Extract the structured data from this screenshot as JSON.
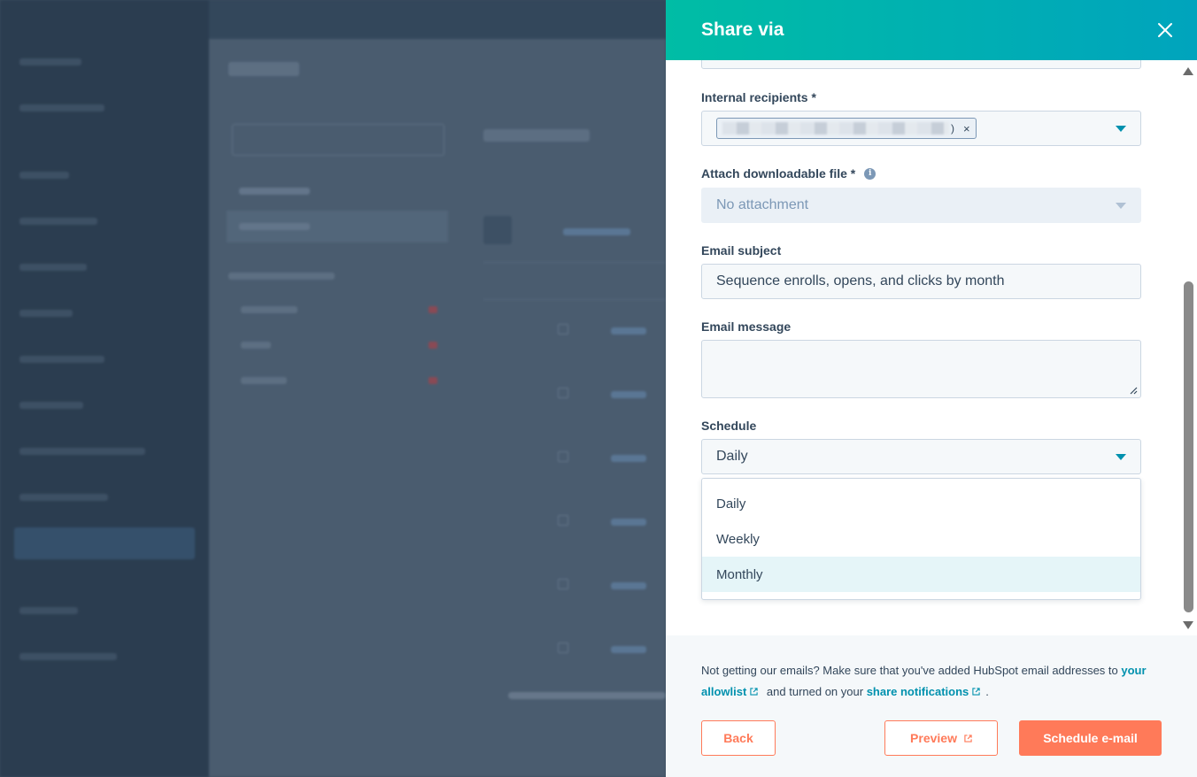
{
  "panel": {
    "title": "Share via",
    "close_icon": "close-icon"
  },
  "form": {
    "internal_recipients": {
      "label": "Internal recipients *",
      "tag_suffix": ")",
      "remove_icon": "×"
    },
    "attach_file": {
      "label": "Attach downloadable file *",
      "info_glyph": "i",
      "value": "No attachment"
    },
    "email_subject": {
      "label": "Email subject",
      "value": "Sequence enrolls, opens, and clicks by month"
    },
    "email_message": {
      "label": "Email message",
      "value": ""
    },
    "schedule": {
      "label": "Schedule",
      "value": "Daily",
      "options": [
        "Daily",
        "Weekly",
        "Monthly"
      ],
      "highlighted": "Monthly"
    }
  },
  "footer": {
    "notice_prefix": "Not getting our emails? Make sure that you've added HubSpot email addresses to",
    "allowlist_link": "your allowlist",
    "notice_middle": "and turned on your",
    "share_link": "share notifications",
    "notice_suffix": ".",
    "back_label": "Back",
    "preview_label": "Preview",
    "schedule_label": "Schedule e-mail"
  },
  "colors": {
    "header_start": "#00bda5",
    "header_end": "#00a4bd",
    "accent_orange": "#ff7a59",
    "link_teal": "#0091ae",
    "text_dark": "#33475b"
  }
}
